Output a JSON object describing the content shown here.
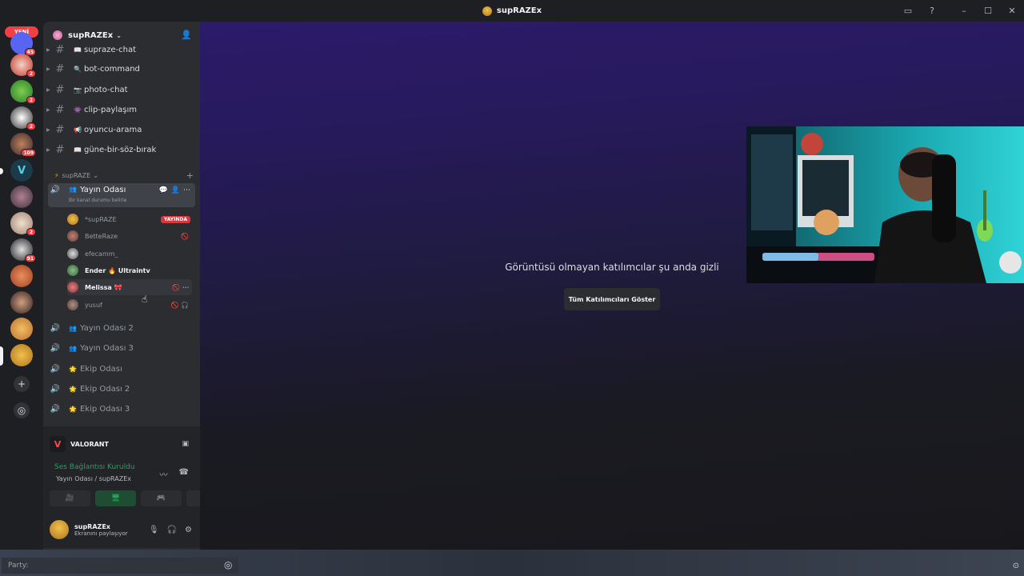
{
  "window": {
    "title": "supRAZEx"
  },
  "guilds": {
    "new_label": "YENİ",
    "badges": [
      "45",
      "2",
      "2",
      "2",
      "109",
      "2",
      "91"
    ]
  },
  "server": {
    "name": "supRAZEx"
  },
  "text_channels": [
    {
      "name": "supraze-chat",
      "emoji": "📖"
    },
    {
      "name": "bot-command",
      "emoji": "🔍"
    },
    {
      "name": "photo-chat",
      "emoji": "📷"
    },
    {
      "name": "clip-paylaşım",
      "emoji": "👾"
    },
    {
      "name": "oyuncu-arama",
      "emoji": "📢"
    },
    {
      "name": "güne-bir-söz-bırak",
      "emoji": "📖"
    }
  ],
  "category": {
    "name": "supRAZE"
  },
  "active_voice": {
    "name": "Yayın Odası",
    "emoji": "👥",
    "status": "Bir kanal durumu belirle",
    "members": [
      {
        "name": "*supRAZE",
        "live": "YAYINDA"
      },
      {
        "name": "BetteRaze"
      },
      {
        "name": "efecamm_"
      },
      {
        "name": "Ender 🔥 Ultraintv"
      },
      {
        "name": "Melissa 🎀"
      },
      {
        "name": "yusuf"
      }
    ]
  },
  "voice_channels": [
    {
      "name": "Yayın Odası 2",
      "emoji": "👥"
    },
    {
      "name": "Yayın Odası 3",
      "emoji": "👥"
    },
    {
      "name": "Ekip Odası",
      "emoji": "🌟"
    },
    {
      "name": "Ekip Odası 2",
      "emoji": "🌟"
    },
    {
      "name": "Ekip Odası 3",
      "emoji": "🌟"
    }
  ],
  "activity": {
    "game": "VALORANT"
  },
  "voice_connection": {
    "status": "Ses Bağlantısı Kuruldu",
    "location": "Yayın Odası / supRAZEx"
  },
  "user": {
    "name": "supRAZEx",
    "status": "Ekranını paylaşıyor"
  },
  "stage": {
    "hidden_message": "Görüntüsü olmayan katılımcılar şu anda gizli",
    "show_all_button": "Tüm Katılımcıları Göster"
  },
  "bottom": {
    "party_placeholder": "Party:"
  },
  "colors": {
    "accent_green": "#23a559",
    "live_red": "#da373c",
    "badge_red": "#f23f43"
  }
}
